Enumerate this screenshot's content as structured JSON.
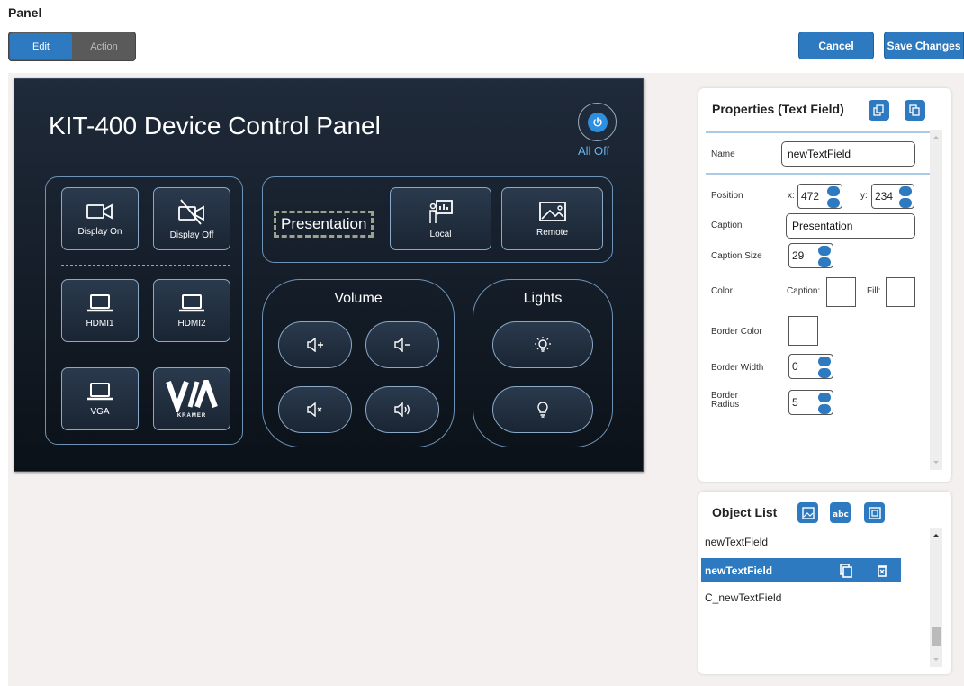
{
  "header": {
    "title": "Panel"
  },
  "mode_toggle": {
    "edit_label": "Edit",
    "action_label": "Action",
    "active": "Edit"
  },
  "actions": {
    "cancel_label": "Cancel",
    "save_label": "Save Changes"
  },
  "device_panel": {
    "title": "KIT-400 Device Control Panel",
    "all_off_label": "All Off",
    "display": {
      "on_label": "Display On",
      "off_label": "Display Off"
    },
    "inputs": {
      "hdmi1_label": "HDMI1",
      "hdmi2_label": "HDMI2",
      "vga_label": "VGA",
      "logo_text": "KRAMER"
    },
    "sources": {
      "text_field_caption": "Presentation",
      "local_label": "Local",
      "remote_label": "Remote"
    },
    "volume": {
      "title": "Volume"
    },
    "lights": {
      "title": "Lights"
    }
  },
  "properties": {
    "title": "Properties (Text Field)",
    "name_label": "Name",
    "name_value": "newTextField",
    "position_label": "Position",
    "x_label": "x:",
    "x_value": "472",
    "y_label": "y:",
    "y_value": "234",
    "caption_label": "Caption",
    "caption_value": "Presentation",
    "caption_size_label": "Caption Size",
    "caption_size_value": "29",
    "color_label": "Color",
    "caption_color_label": "Caption:",
    "fill_color_label": "Fill:",
    "border_color_label": "Border Color",
    "border_width_label": "Border Width",
    "border_width_value": "0",
    "border_radius_label_line1": "Border",
    "border_radius_label_line2": "Radius",
    "border_radius_value": "5"
  },
  "object_list": {
    "title": "Object List",
    "items": [
      {
        "label": "newTextField",
        "selected": false
      },
      {
        "label": "newTextField",
        "selected": true
      },
      {
        "label": "C_newTextField",
        "selected": false
      }
    ]
  },
  "colors": {
    "accent": "#2d7ac0",
    "panel_bg": "#16202c",
    "outline": "#6d93b8",
    "link": "#6ab4f0"
  }
}
